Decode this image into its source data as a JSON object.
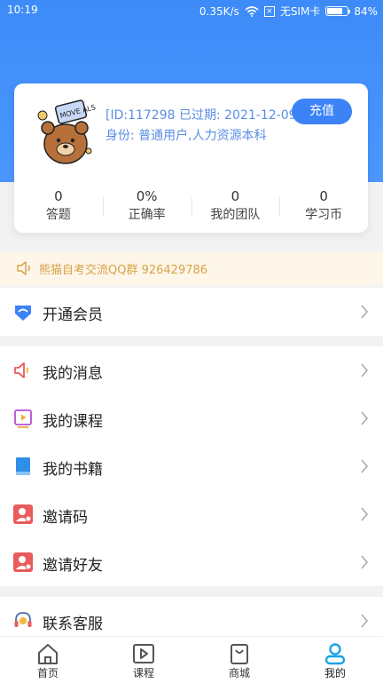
{
  "status_bar": {
    "time": "10:19",
    "speed": "0.35K/s",
    "sim": "无SIM卡",
    "battery": "84%",
    "battery_level": 0.84
  },
  "profile": {
    "id_line": "[ID:117298 已过期: 2021-12-09]",
    "identity": "身份:  普通用户,人力资源本科",
    "recharge_label": "充值",
    "avatar_text": "MOVE ALS",
    "stats": [
      {
        "value": "0",
        "label": "答题"
      },
      {
        "value": "0%",
        "label": "正确率"
      },
      {
        "value": "0",
        "label": "我的团队"
      },
      {
        "value": "0",
        "label": "学习币"
      }
    ]
  },
  "notice": {
    "text": "熊猫自考交流QQ群 926429786"
  },
  "menu": {
    "vip": "开通会员",
    "messages": "我的消息",
    "courses": "我的课程",
    "books": "我的书籍",
    "invite_code": "邀请码",
    "invite_friends": "邀请好友",
    "support": "联系客服"
  },
  "tabs": [
    {
      "label": "首页"
    },
    {
      "label": "课程"
    },
    {
      "label": "商城"
    },
    {
      "label": "我的"
    }
  ],
  "colors": {
    "brand": "#3b83f7",
    "notice": "#d8a349",
    "active_tab": "#1aa3e8"
  }
}
